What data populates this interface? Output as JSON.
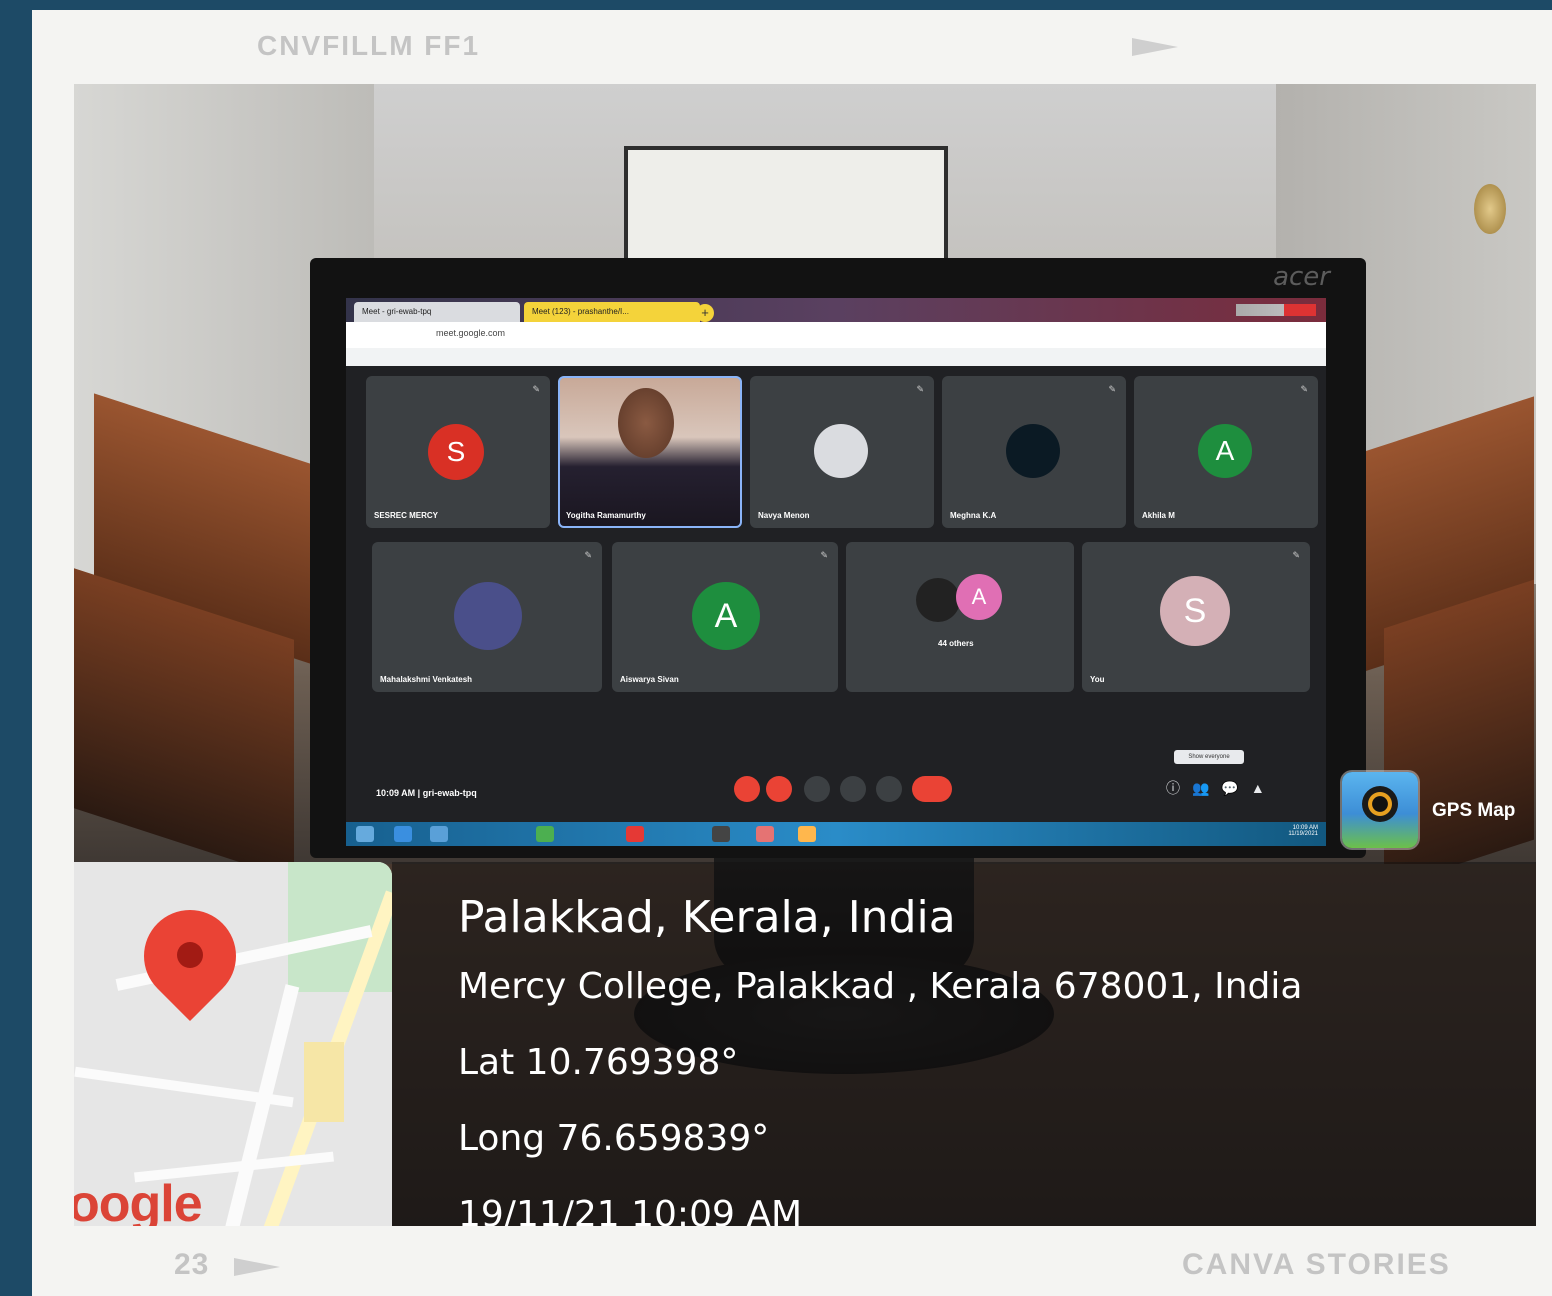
{
  "film": {
    "top_label": "CNVFILLM FF1",
    "frame_number": "23",
    "bottom_label": "CANVA STORIES"
  },
  "monitor": {
    "brand": "acer",
    "browser": {
      "tab1": "Meet - gri-ewab-tpq",
      "tab2": "Meet (123) - prashanthe/I..."
    },
    "tiles_row1": [
      {
        "name": "SESREC MERCY",
        "avatar": "S",
        "color": "#d93025"
      },
      {
        "name": "Yogitha Ramamurthy",
        "avatar": "",
        "color": ""
      },
      {
        "name": "Navya Menon",
        "avatar": "",
        "color": "#dadce0"
      },
      {
        "name": "Meghna K.A",
        "avatar": "",
        "color": "#0b1a24"
      },
      {
        "name": "Akhila M",
        "avatar": "A",
        "color": "#1e8e3e"
      }
    ],
    "tiles_row2": [
      {
        "name": "Mahalakshmi Venkatesh",
        "avatar": "",
        "color": "#4a4f8a"
      },
      {
        "name": "Aiswarya Sivan",
        "avatar": "A",
        "color": "#1e8e3e"
      },
      {
        "name": "44 others",
        "avatar": "A",
        "color": "#e06fb4"
      },
      {
        "name": "You",
        "avatar": "S",
        "color": "#d4b0b6"
      }
    ],
    "meeting_time": "10:09 AM  |  gri-ewab-tpq",
    "tooltip": "Show everyone"
  },
  "gps_app": {
    "label": "GPS Map"
  },
  "map": {
    "google": "oogle"
  },
  "location": {
    "title": "Palakkad, Kerala, India",
    "address": "Mercy College, Palakkad , Kerala 678001, India",
    "lat": "Lat 10.769398°",
    "long": "Long 76.659839°",
    "datetime": "19/11/21 10:09 AM"
  }
}
